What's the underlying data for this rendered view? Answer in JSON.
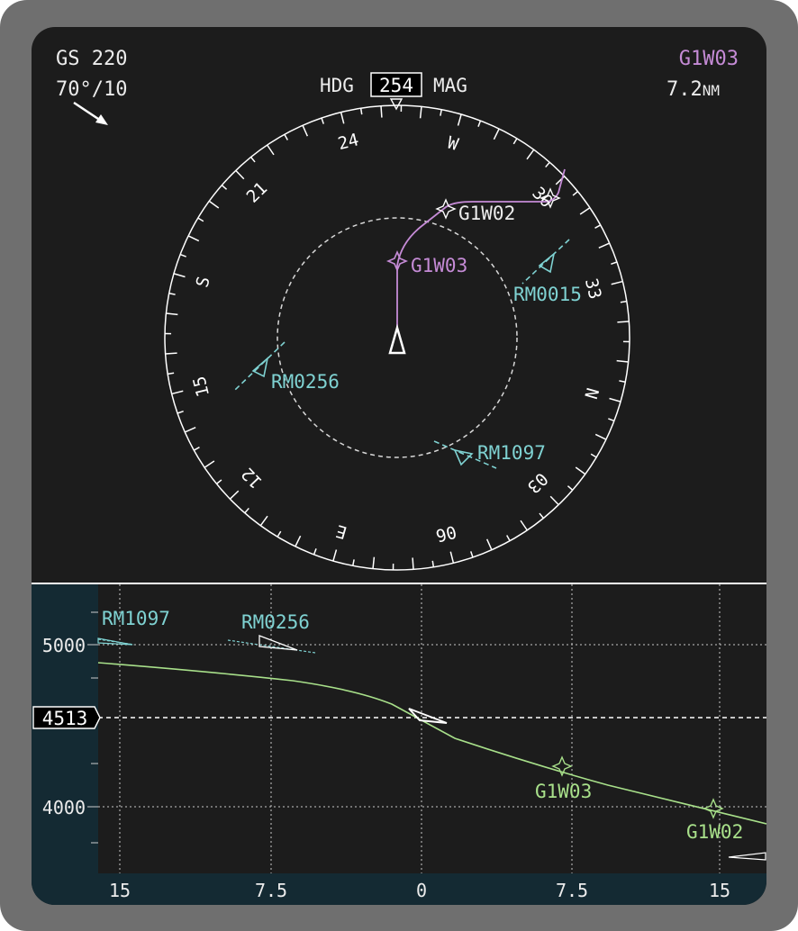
{
  "header": {
    "ground_speed": "GS 220",
    "wind": "70°/10",
    "heading_label": "HDG",
    "heading_value": "254",
    "heading_ref": "MAG",
    "active_waypoint": "G1W03",
    "distance_value": "7.2",
    "distance_unit": "NM"
  },
  "compass": {
    "labels": [
      "24",
      "W",
      "30",
      "33",
      "N",
      "03",
      "06",
      "E",
      "12",
      "15",
      "S",
      "21"
    ]
  },
  "nd_waypoints": [
    {
      "name": "G1W02"
    },
    {
      "name": "G1W03"
    }
  ],
  "traffic": [
    {
      "name": "RM0015"
    },
    {
      "name": "RM0256"
    },
    {
      "name": "RM1097"
    }
  ],
  "vsd": {
    "altitude_ticks": [
      "5000",
      "4000"
    ],
    "current_altitude": "4513",
    "distance_ticks": [
      "15",
      "7.5",
      "0",
      "7.5",
      "15"
    ],
    "traffic": [
      {
        "name": "RM1097"
      },
      {
        "name": "RM0256"
      }
    ],
    "waypoints": [
      {
        "name": "G1W03"
      },
      {
        "name": "G1W02"
      }
    ]
  },
  "colors": {
    "bezel": "#6f6f6f",
    "screen": "#1c1c1c",
    "route": "#c58bd6",
    "traffic": "#7fd2d2",
    "profile": "#a8e08a",
    "vsd_axis": "#142a33"
  }
}
